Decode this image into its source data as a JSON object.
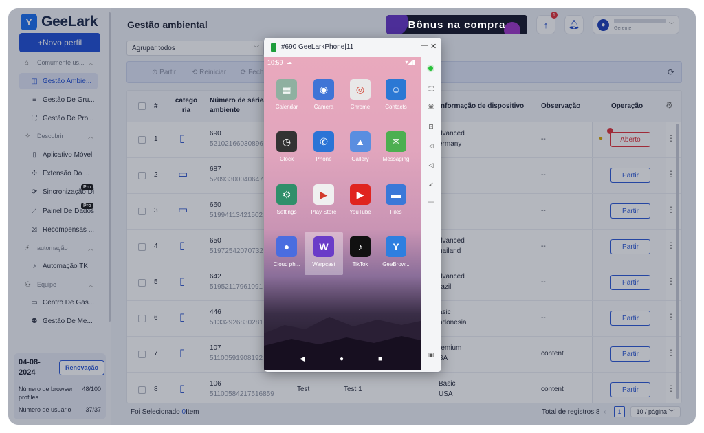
{
  "sidebar": {
    "logo_text": "GeeLark",
    "new_profile_label": "+Novo perfil",
    "sections": [
      {
        "label": "Comumente us...",
        "items": [
          "Gestão Ambie...",
          "Gestão De Gru...",
          "Gestão De Pro..."
        ]
      },
      {
        "label": "Descobrir",
        "items": [
          "Aplicativo Móvel",
          "Extensão Do ...",
          "Sincronização Di",
          "Painel De Dados",
          "Recompensas ..."
        ]
      },
      {
        "label": "automação",
        "items": [
          "Automação TK"
        ]
      },
      {
        "label": "Equipe",
        "items": [
          "Centro De Gas...",
          "Gestão De Me..."
        ]
      }
    ],
    "pro_badge": "Pro",
    "plan": {
      "date": "04-08-2024",
      "renew_label": "Renovação",
      "profiles_label": "Número de browser profiles",
      "profiles_value": "48/100",
      "users_label": "Número de usuário",
      "users_value": "37/37"
    }
  },
  "header": {
    "page_title": "Gestão ambiental",
    "bonus_text": "Bônus na compra",
    "upload_badge": "1",
    "user_role": "Gerente"
  },
  "filter": {
    "group_select": "Agrupar todos"
  },
  "toolbar": {
    "share": "Partir",
    "restart": "Reiniciar",
    "close": "Fech"
  },
  "table": {
    "headers": {
      "num": "#",
      "category": "catego ria",
      "serial": "Número de série/ ambiente",
      "device_info": "nformação de dispositivo",
      "remark": "Observação",
      "operation": "Operação"
    },
    "rows": [
      {
        "num": "1",
        "device": "phone",
        "serial": "690",
        "env": "52102166030896",
        "info1": "dvanced",
        "info2": "ermany",
        "remark": "--",
        "op": "Aberto"
      },
      {
        "num": "2",
        "device": "desktop",
        "serial": "687",
        "env": "52093300040647",
        "info1": "-",
        "info2": "",
        "remark": "--",
        "op": "Partir"
      },
      {
        "num": "3",
        "device": "desktop",
        "serial": "660",
        "env": "51994113421502",
        "info1": "-",
        "info2": "",
        "remark": "--",
        "op": "Partir"
      },
      {
        "num": "4",
        "device": "phone",
        "serial": "650",
        "env": "51972542070732",
        "info1": "dvanced",
        "info2": "hailand",
        "remark": "--",
        "op": "Partir"
      },
      {
        "num": "5",
        "device": "phone",
        "serial": "642",
        "env": "51952117961091",
        "info1": "dvanced",
        "info2": "razil",
        "remark": "--",
        "op": "Partir"
      },
      {
        "num": "6",
        "device": "phone",
        "serial": "446",
        "env": "51332926830281",
        "info1": "asic",
        "info2": "ndonesia",
        "remark": "--",
        "op": "Partir"
      },
      {
        "num": "7",
        "device": "phone",
        "serial": "107",
        "env": "51100591908192",
        "info1": "remium",
        "info2": "SA",
        "remark": "content",
        "op": "Partir"
      },
      {
        "num": "8",
        "device": "phone",
        "serial": "106",
        "env": "51100584217516859",
        "col_a": "Test",
        "col_b": "Test 1",
        "info1": "Basic",
        "info2": "USA",
        "remark": "content",
        "op": "Partir"
      }
    ]
  },
  "footer": {
    "selected_prefix": "Foi Selecionado",
    "selected_count": "0",
    "selected_suffix": "Item",
    "total": "Total de registros 8",
    "page": "1",
    "page_size": "10 / página"
  },
  "phone": {
    "title": "#690 GeeLarkPhone|11",
    "time": "10:59",
    "apps": [
      {
        "label": "Calendar",
        "color": "#8fb0a0",
        "glyph": "▦"
      },
      {
        "label": "Camera",
        "color": "#3f74d6",
        "glyph": "◉"
      },
      {
        "label": "Chrome",
        "color": "#e8e8e8",
        "glyph": "◎"
      },
      {
        "label": "Contacts",
        "color": "#2b78d4",
        "glyph": "☺"
      },
      {
        "label": "Clock",
        "color": "#333333",
        "glyph": "◷"
      },
      {
        "label": "Phone",
        "color": "#2b74d6",
        "glyph": "✆"
      },
      {
        "label": "Gallery",
        "color": "#5a8ee0",
        "glyph": "▲"
      },
      {
        "label": "Messaging",
        "color": "#4caf50",
        "glyph": "✉"
      },
      {
        "label": "Settings",
        "color": "#2f8f6a",
        "glyph": "⚙"
      },
      {
        "label": "Play Store",
        "color": "#f0f0f0",
        "glyph": "▶"
      },
      {
        "label": "YouTube",
        "color": "#e0241f",
        "glyph": "▶"
      },
      {
        "label": "Files",
        "color": "#3a78d8",
        "glyph": "▬"
      },
      {
        "label": "Cloud ph...",
        "color": "#4a6de0",
        "glyph": "●"
      },
      {
        "label": "Warpcast",
        "color": "#6a3cc8",
        "glyph": "W"
      },
      {
        "label": "TikTok",
        "color": "#111111",
        "glyph": "♪"
      },
      {
        "label": "GeeBrow...",
        "color": "#2d7fe0",
        "glyph": "Y"
      }
    ]
  }
}
